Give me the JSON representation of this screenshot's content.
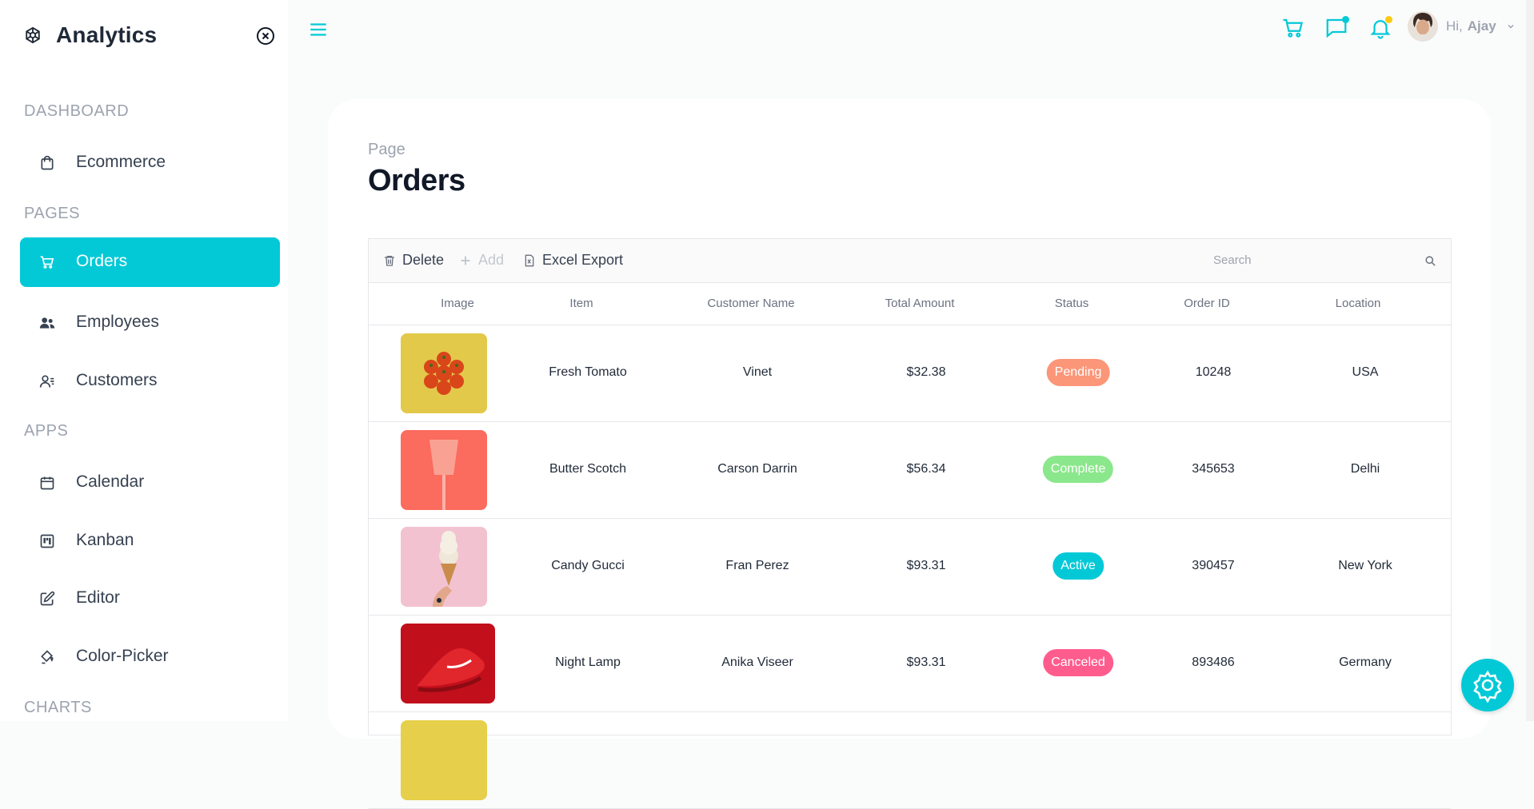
{
  "app": {
    "title": "Analytics"
  },
  "sidebar": {
    "sections": [
      {
        "title": "DASHBOARD"
      },
      {
        "title": "PAGES"
      },
      {
        "title": "APPS"
      },
      {
        "title": "CHARTS"
      }
    ],
    "items": [
      {
        "label": "Ecommerce",
        "icon": "shopping-bag-icon"
      },
      {
        "label": "Orders",
        "icon": "cart-icon",
        "active": true
      },
      {
        "label": "Employees",
        "icon": "people-icon"
      },
      {
        "label": "Customers",
        "icon": "customers-icon"
      },
      {
        "label": "Calendar",
        "icon": "calendar-icon"
      },
      {
        "label": "Kanban",
        "icon": "kanban-icon"
      },
      {
        "label": "Editor",
        "icon": "edit-icon"
      },
      {
        "label": "Color-Picker",
        "icon": "color-picker-icon"
      }
    ]
  },
  "header": {
    "greeting": "Hi,",
    "username": "Ajay",
    "accent": "#03c9d7",
    "chat_dot_color": "#03c9d7",
    "notification_dot_color": "#fec90f"
  },
  "page": {
    "subtitle": "Page",
    "title": "Orders"
  },
  "toolbar": {
    "delete_label": "Delete",
    "add_label": "Add",
    "export_label": "Excel Export",
    "search_placeholder": "Search"
  },
  "table": {
    "columns": [
      "Image",
      "Item",
      "Customer Name",
      "Total Amount",
      "Status",
      "Order ID",
      "Location"
    ],
    "rows": [
      {
        "item": "Fresh Tomato",
        "customer": "Vinet",
        "amount": "$32.38",
        "status": "Pending",
        "status_color": "#fb9678",
        "order_id": "10248",
        "location": "USA"
      },
      {
        "item": "Butter Scotch",
        "customer": "Carson Darrin",
        "amount": "$56.34",
        "status": "Complete",
        "status_color": "#8be78b",
        "order_id": "345653",
        "location": "Delhi"
      },
      {
        "item": "Candy Gucci",
        "customer": "Fran Perez",
        "amount": "$93.31",
        "status": "Active",
        "status_color": "#03c9d7",
        "order_id": "390457",
        "location": "New York"
      },
      {
        "item": "Night Lamp",
        "customer": "Anika Viseer",
        "amount": "$93.31",
        "status": "Canceled",
        "status_color": "#ff5c8e",
        "order_id": "893486",
        "location": "Germany"
      }
    ]
  }
}
